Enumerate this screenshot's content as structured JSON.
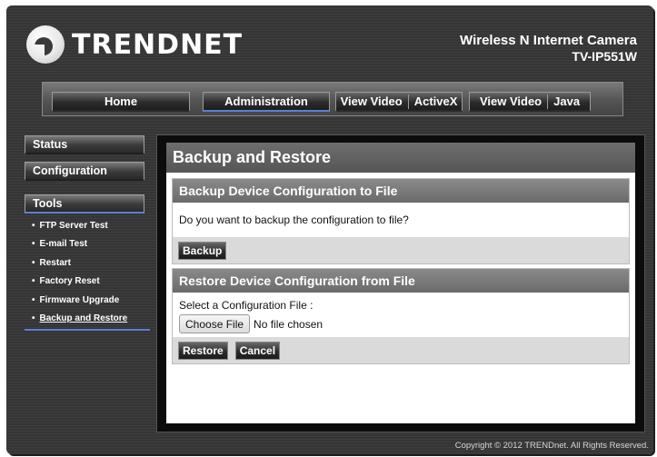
{
  "brand": {
    "logo_text": "TRENDNET"
  },
  "product": {
    "name": "Wireless N Internet Camera",
    "model": "TV-IP551W"
  },
  "nav": {
    "home": "Home",
    "administration": "Administration",
    "view_video_activex_a": "View Video",
    "view_video_activex_b": "ActiveX",
    "view_video_java_a": "View Video",
    "view_video_java_b": "Java",
    "active": "Administration"
  },
  "sidebar": {
    "status": "Status",
    "configuration": "Configuration",
    "tools": "Tools",
    "tools_items": [
      "FTP Server Test",
      "E-mail Test",
      "Restart",
      "Factory Reset",
      "Firmware Upgrade",
      "Backup and Restore"
    ],
    "current": "Backup and Restore"
  },
  "main": {
    "title": "Backup and Restore",
    "backup": {
      "heading": "Backup Device Configuration to File",
      "question": "Do you want to backup the configuration to file?",
      "button": "Backup"
    },
    "restore": {
      "heading": "Restore Device Configuration from File",
      "label": "Select a Configuration File :",
      "choose_button": "Choose File",
      "file_status": "No file chosen",
      "restore_button": "Restore",
      "cancel_button": "Cancel"
    }
  },
  "footer": {
    "copyright": "Copyright © 2012 TRENDnet.  All Rights Reserved."
  },
  "colors": {
    "accent": "#5b7fd6",
    "frame_bg": "#3a3a3a",
    "section_head": "#7a7a7a"
  }
}
